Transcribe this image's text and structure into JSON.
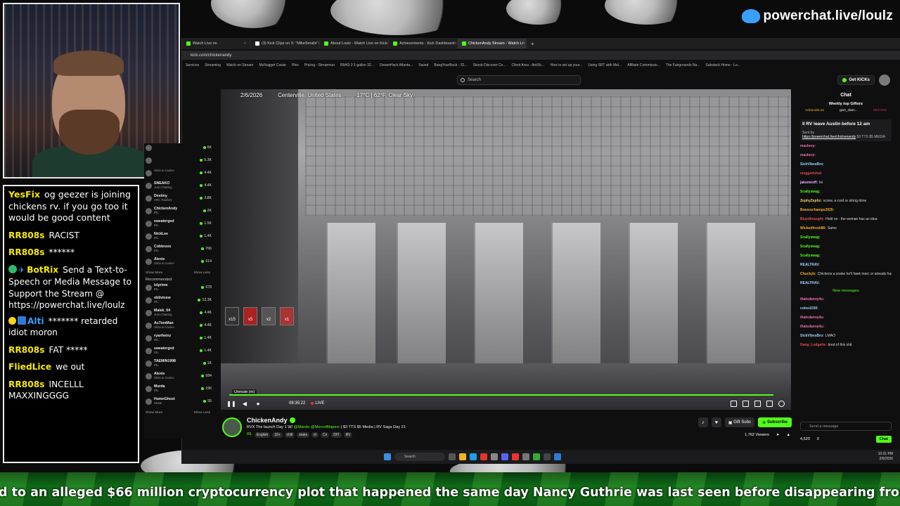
{
  "brand": {
    "label": "powerchat.live/loulz"
  },
  "chat_overlay": {
    "messages": [
      {
        "user": "YesFix",
        "text": "og geezer is joining chickens rv. if you go too it would be good content"
      },
      {
        "user": "RR808s",
        "text": "RACIST"
      },
      {
        "user": "RR808s",
        "text": "******"
      },
      {
        "user": "BotRix",
        "text": "Send a Text-to-Speech or Media Message to Support the Stream @ https://powerchat.live/loulz"
      },
      {
        "user": "Alti",
        "text": "******* retarded idiot moron"
      },
      {
        "user": "RR808s",
        "text": "FAT *****"
      },
      {
        "user": "FliedLice",
        "text": "we out"
      },
      {
        "user": "RR808s",
        "text": "INCELLL MAXXINGGGG"
      }
    ]
  },
  "browser": {
    "tabs": [
      {
        "label": "Watch Live on"
      },
      {
        "label": "(3) Kick Clips on X: \"MikeSmalls\""
      },
      {
        "label": "About Loulz - Watch Live on Kick"
      },
      {
        "label": "Achievements - Kick Dashboard"
      },
      {
        "label": "ChickenAndy Stream - Watch Li"
      }
    ],
    "url": "kick.com/chickenandy",
    "bookmarks": [
      "Services",
      "Streaming",
      "Watch on Stream",
      "McNugget Caviar",
      "Plex",
      "Pricing - Streamrun",
      "RM43-2 1-gallon 32...",
      "DreamHack Atlanta...",
      "Saved",
      "BangYourBuck - 32...",
      "Skoob Discover Co...",
      "Client Area - AntiSc...",
      "How to set up your...",
      "Using SRT with Mel...",
      "Affiliate Commissio...",
      "The Fairgrounds Na...",
      "Substack Home - Lo..."
    ]
  },
  "kick": {
    "search_placeholder": "Search",
    "get_kicks": "Get KICKs"
  },
  "sidebar": {
    "following": [
      {
        "name": "",
        "sub": "",
        "count": "6K"
      },
      {
        "name": "",
        "sub": "",
        "count": "5.3K"
      },
      {
        "name": "",
        "sub": "Slots & Casino",
        "count": "4.4K"
      },
      {
        "name": "SNEAKO",
        "sub": "Just Chatting",
        "count": "4.4K"
      },
      {
        "name": "Destiny",
        "sub": "ARC Raiders",
        "count": "2.8K"
      },
      {
        "name": "ChickenAndy",
        "sub": "IRL",
        "count": "2K"
      },
      {
        "name": "sweatergxd",
        "sub": "IRL",
        "count": "1.5K"
      },
      {
        "name": "NickLee",
        "sub": "IRL",
        "count": "1.4K"
      },
      {
        "name": "Cobbruvs",
        "sub": "IRL",
        "count": "766"
      },
      {
        "name": "Alexis",
        "sub": "Slots & Casino",
        "count": "614"
      }
    ],
    "show_more": "Show More",
    "show_less": "Show Less",
    "recommended_header": "Recommended",
    "recommended": [
      {
        "name": "lzlprime",
        "sub": "IRL",
        "count": "678"
      },
      {
        "name": "obliviosw",
        "sub": "IRL",
        "count": "13.3K"
      },
      {
        "name": "Malek_04",
        "sub": "Just Chatting",
        "count": "4.4K"
      },
      {
        "name": "Ac7ionMan",
        "sub": "Slots & Casino",
        "count": "4.4K"
      },
      {
        "name": "ryanheinz",
        "sub": "IRL",
        "count": "1.4K"
      },
      {
        "name": "sweatergxd",
        "sub": "IRL",
        "count": "1.4K"
      },
      {
        "name": "TAEMIN1998",
        "sub": "IRL",
        "count": "1K"
      },
      {
        "name": "Alexis",
        "sub": "Slots & Casino",
        "count": "584"
      },
      {
        "name": "Murda",
        "sub": "IRL",
        "count": "196"
      },
      {
        "name": "HumnGhost",
        "sub": "Skate",
        "count": "55"
      }
    ]
  },
  "video": {
    "date": "2/6/2026",
    "location": "Centerville, United States",
    "weather": "17°C | 62°F, Clear Sky",
    "unmute_tip": "Unmute (m)",
    "time": "08:35:22",
    "live": "LIVE",
    "progress": 0.98
  },
  "stream": {
    "name": "ChickenAndy",
    "title_prefix": "RVX The launch Day 1 W/ ",
    "title_mentions": "@Mando @Mercoffdaperc",
    "title_suffix": " | $3 TTS $5 Media | RV Saga Day 21",
    "category": "IRL",
    "tags": [
      "English",
      "18+",
      "chill",
      "stake",
      "irl",
      "Cx",
      "DIY",
      "RV"
    ],
    "gift_subs": "Gift Subs",
    "subscribe": "Subscribe",
    "viewers": "1,762 Viewers"
  },
  "kick_chat": {
    "title": "Chat",
    "gifters_title": "Weekly top Gifters",
    "gifters": [
      "AdrianahLee",
      "give_clam...",
      "RBTARD"
    ],
    "pinned_title": "ll RV leave Austin before 12 am",
    "pinned_sent_by": "Sent by",
    "pinned_link": "https://powerchat.live/chickenandy",
    "pinned_rest": " $3 TTS $5 MEDIA",
    "messages": [
      {
        "user": "mackery:",
        "text": "",
        "color": "#f06fb0"
      },
      {
        "user": "mackery:",
        "text": "",
        "color": "#f06fb0"
      },
      {
        "user": "SickVibesBro:",
        "text": "",
        "color": "#9fd4ff"
      },
      {
        "user": "meggedshot:",
        "text": "",
        "color": "#e34a4a"
      },
      {
        "user": "jakemeoff:",
        "text": "lol",
        "color": "#e6b3ff"
      },
      {
        "user": "Scallyswag:",
        "text": "",
        "color": "#53fc18"
      },
      {
        "user": "ZephyZephz:",
        "text": "screw, a cord or string done",
        "color": "#ffd26a"
      },
      {
        "user": "Braveschamps2025:",
        "text": "",
        "color": "#f6b21a"
      },
      {
        "user": "Bluedhraught:",
        "text": "Hold on - the woman has an idea",
        "color": "#e34a4a"
      },
      {
        "user": "Wickedfresh86:",
        "text": "Same",
        "color": "#f6b21a"
      },
      {
        "user": "Scallyswag:",
        "text": "",
        "color": "#53fc18"
      },
      {
        "user": "Scallyswag:",
        "text": "",
        "color": "#53fc18"
      },
      {
        "user": "Scallyswag:",
        "text": "",
        "color": "#53fc18"
      },
      {
        "user": "REALTRAV:",
        "text": "",
        "color": "#9fd4ff"
      },
      {
        "user": "Chuckyb:",
        "text": "Chickens a snake he'll fawk merc or already has before",
        "color": "#f6b21a"
      },
      {
        "user": "REALTRAV:",
        "text": "",
        "color": "#9fd4ff"
      }
    ],
    "new_messages": "New messages",
    "messages_after": [
      {
        "user": "thatsdanny4u:",
        "text": "",
        "color": "#f06fb0"
      },
      {
        "user": "coleo1030:",
        "text": "",
        "color": "#9fd4ff"
      },
      {
        "user": "thatsdanny4u:",
        "text": "",
        "color": "#f06fb0"
      },
      {
        "user": "thatsdanny4u:",
        "text": "",
        "color": "#f06fb0"
      },
      {
        "user": "SickVibesBro:",
        "text": "LMAO",
        "color": "#9fd4ff"
      },
      {
        "user": "Dang_Lodgeite:",
        "text": "tired of this shit",
        "color": "#e34a4a"
      }
    ],
    "input_placeholder": "Send a message",
    "kicks_count": "4,520",
    "zero": "0",
    "chat_button": "Chat"
  },
  "taskbar": {
    "search": "Search",
    "time": "10:31 PM",
    "date": "2/6/2026"
  },
  "ticker": {
    "text": "d to an alleged $66 million cryptocurrency plot that happened the same day Nancy Guthrie was last seen before disappearing from her Tucson home about t"
  }
}
